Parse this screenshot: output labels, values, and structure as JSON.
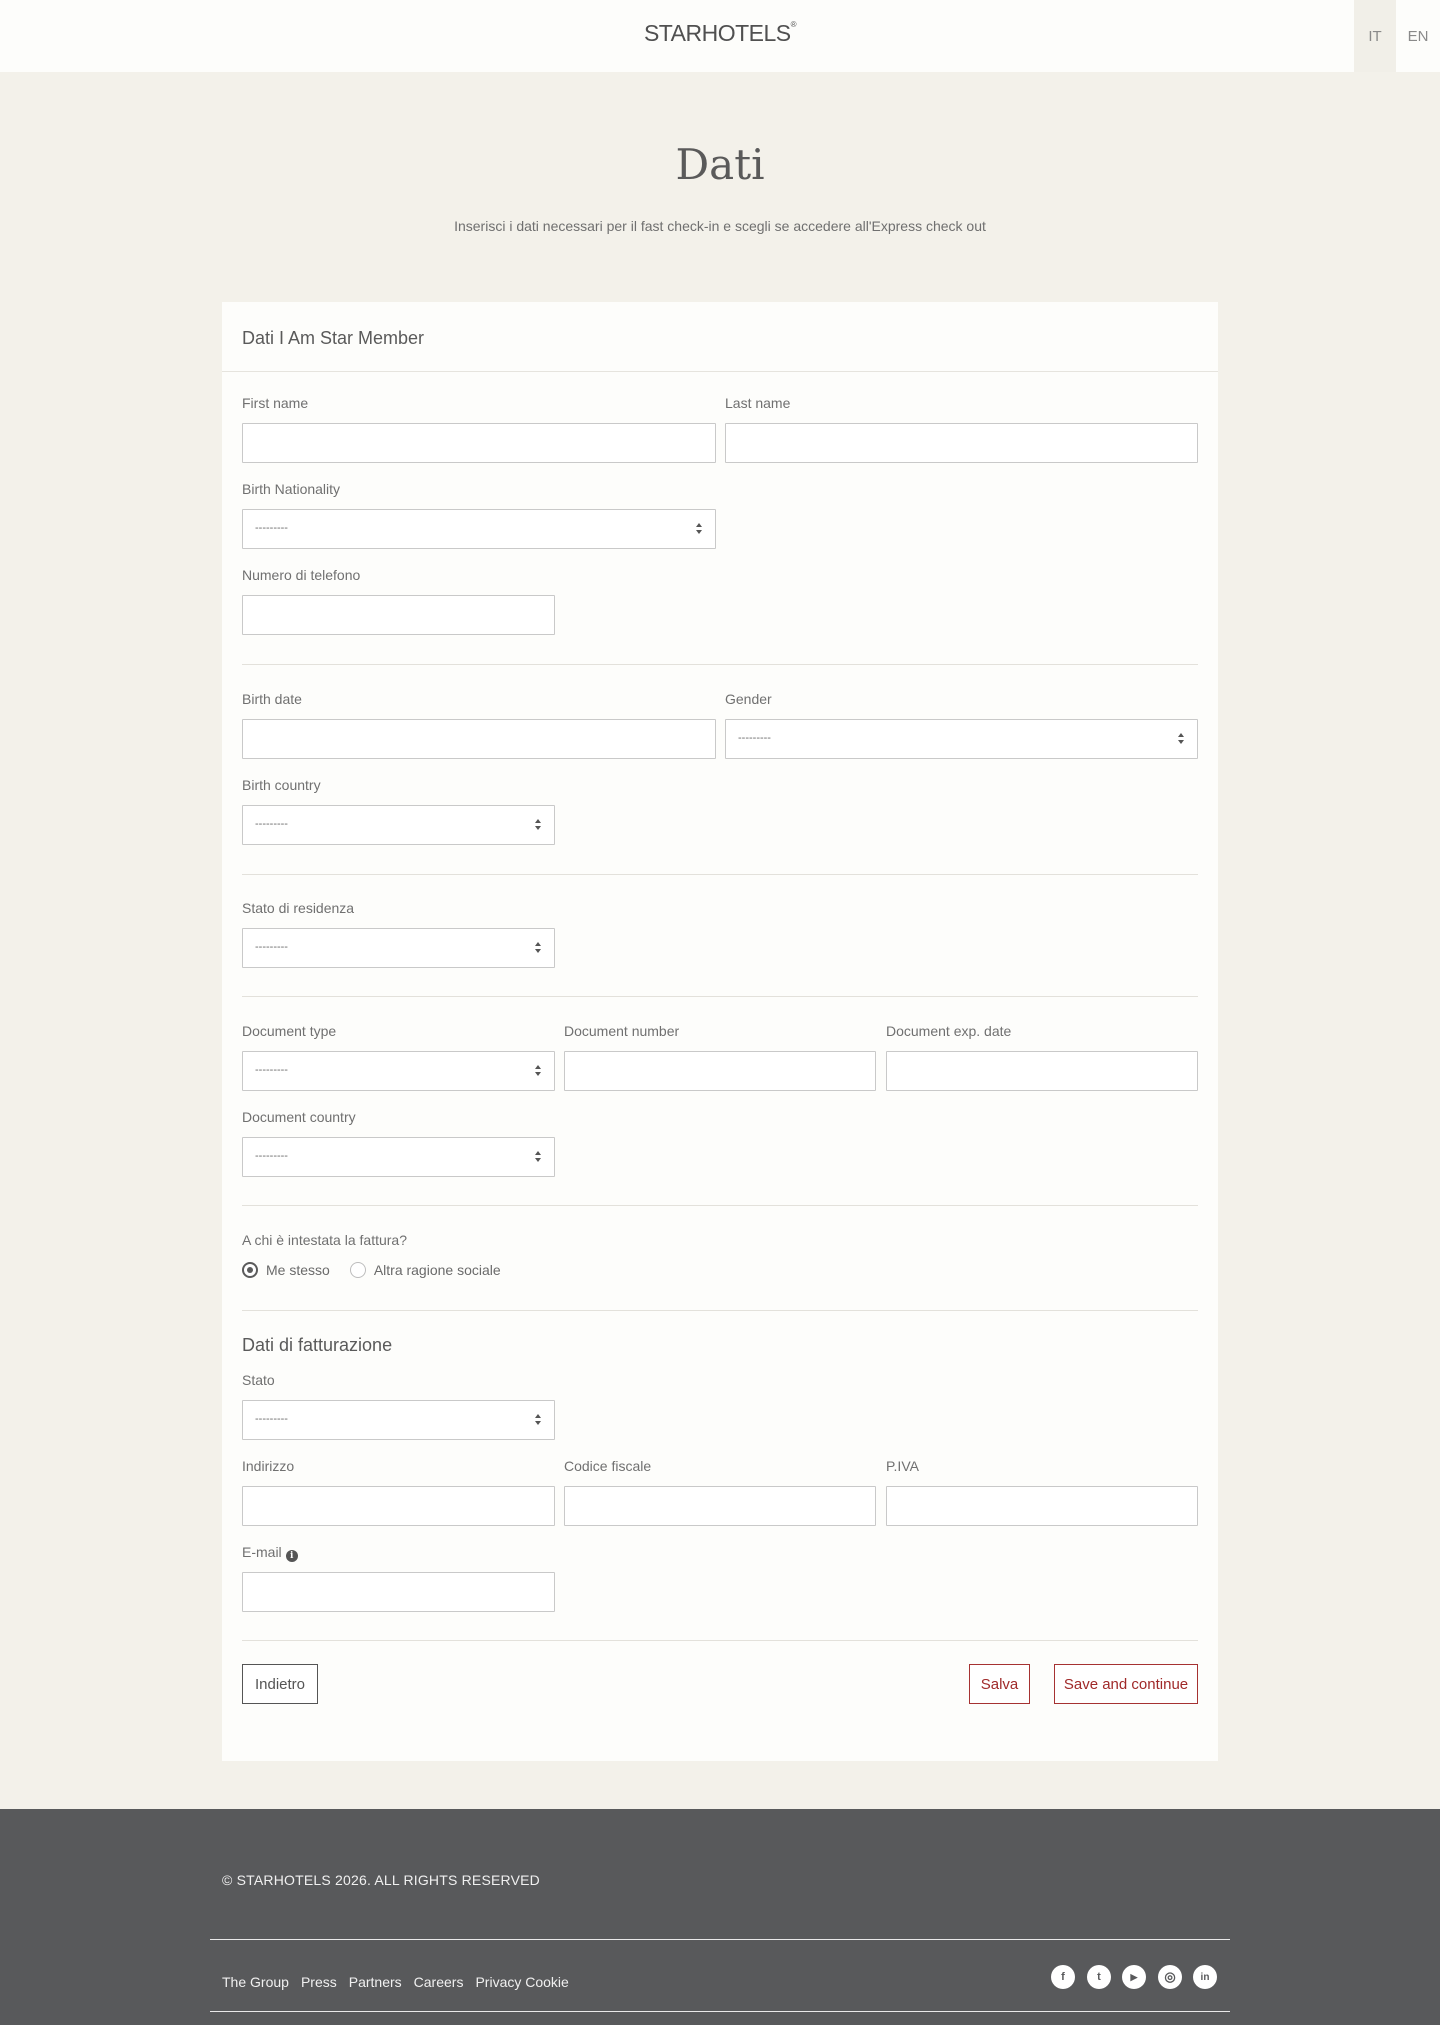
{
  "header": {
    "logo": "STARHOTELS",
    "logo_mark": "®",
    "lang_it": "IT",
    "lang_en": "EN"
  },
  "page": {
    "title": "Dati",
    "subtitle": "Inserisci i dati necessari per il fast check-in e scegli se accedere all'Express check out"
  },
  "card": {
    "heading": "Dati I Am Star Member",
    "first_name_label": "First name",
    "last_name_label": "Last name",
    "birth_nationality_label": "Birth Nationality",
    "birth_nationality_value": "---------",
    "phone_label": "Numero di telefono",
    "birth_date_label": "Birth date",
    "gender_label": "Gender",
    "gender_value": "---------",
    "birth_country_label": "Birth country",
    "birth_country_value": "---------",
    "residence_label": "Stato di residenza",
    "residence_value": "---------",
    "doc_type_label": "Document type",
    "doc_type_value": "---------",
    "doc_number_label": "Document number",
    "doc_exp_label": "Document exp. date",
    "doc_country_label": "Document country",
    "doc_country_value": "---------",
    "invoice_question": "A chi è intestata la fattura?",
    "radio_self": "Me stesso",
    "radio_other": "Altra ragione sociale",
    "billing_title": "Dati di fatturazione",
    "stato_label": "Stato",
    "stato_value": "---------",
    "address_label": "Indirizzo",
    "tax_code_label": "Codice fiscale",
    "vat_label": "P.IVA",
    "email_label": "E-mail",
    "info_icon_glyph": "i"
  },
  "buttons": {
    "back": "Indietro",
    "save": "Salva",
    "save_continue": "Save and continue"
  },
  "footer": {
    "copyright": "© STARHOTELS 2026. ALL RIGHTS RESERVED",
    "links": [
      "The Group",
      "Press",
      "Partners",
      "Careers",
      "Privacy Cookie"
    ],
    "social": [
      {
        "icon": "facebook-icon",
        "glyph": "f"
      },
      {
        "icon": "twitter-icon",
        "glyph": "t"
      },
      {
        "icon": "youtube-icon",
        "glyph": "▶"
      },
      {
        "icon": "instagram-icon",
        "glyph": "◎"
      },
      {
        "icon": "linkedin-icon",
        "glyph": "in"
      }
    ]
  }
}
